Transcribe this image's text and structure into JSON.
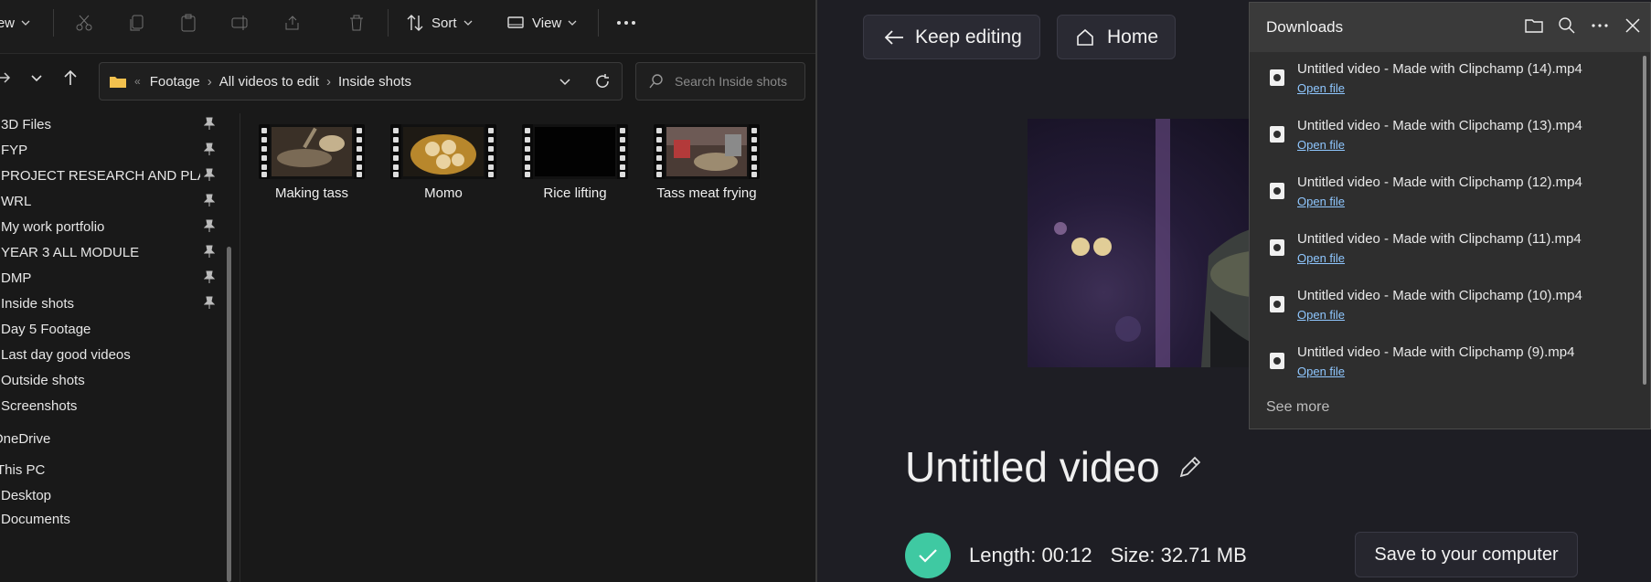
{
  "explorer": {
    "toolbar": {
      "new_label": "New",
      "sort_label": "Sort",
      "view_label": "View"
    },
    "address": {
      "path": [
        "Footage",
        "All videos to edit",
        "Inside shots"
      ]
    },
    "search": {
      "placeholder": "Search Inside shots"
    },
    "nav": {
      "items": [
        {
          "label": "3D Files",
          "pinned": true
        },
        {
          "label": "FYP",
          "pinned": true
        },
        {
          "label": "PROJECT RESEARCH AND PLANN",
          "pinned": true
        },
        {
          "label": "WRL",
          "pinned": true
        },
        {
          "label": "My work portfolio",
          "pinned": true
        },
        {
          "label": "YEAR 3 ALL MODULE",
          "pinned": true
        },
        {
          "label": "DMP",
          "pinned": true
        },
        {
          "label": "Inside shots",
          "pinned": true
        },
        {
          "label": "Day 5 Footage",
          "pinned": false
        },
        {
          "label": "Last day good videos",
          "pinned": false
        },
        {
          "label": "Outside shots",
          "pinned": false
        },
        {
          "label": "Screenshots",
          "pinned": false
        },
        {
          "label": "OneDrive",
          "pinned": false
        },
        {
          "label": "This PC",
          "pinned": false
        },
        {
          "label": "Desktop",
          "pinned": false
        },
        {
          "label": "Documents",
          "pinned": false
        }
      ]
    },
    "files": [
      {
        "name": "Making tass"
      },
      {
        "name": "Momo"
      },
      {
        "name": "Rice lifting"
      },
      {
        "name": "Tass meat frying"
      }
    ]
  },
  "clipchamp": {
    "keep_editing_label": "Keep editing",
    "home_label": "Home",
    "video_title": "Untitled video",
    "length_text": "Length: 00:12",
    "size_text": "Size: 32.71 MB",
    "save_label": "Save to your computer"
  },
  "downloads": {
    "title": "Downloads",
    "items": [
      {
        "name": "Untitled video - Made with Clipchamp (14).mp4",
        "link": "Open file"
      },
      {
        "name": "Untitled video - Made with Clipchamp (13).mp4",
        "link": "Open file"
      },
      {
        "name": "Untitled video - Made with Clipchamp (12).mp4",
        "link": "Open file"
      },
      {
        "name": "Untitled video - Made with Clipchamp (11).mp4",
        "link": "Open file"
      },
      {
        "name": "Untitled video - Made with Clipchamp (10).mp4",
        "link": "Open file"
      },
      {
        "name": "Untitled video - Made with Clipchamp (9).mp4",
        "link": "Open file"
      }
    ],
    "see_more_label": "See more"
  },
  "colors": {
    "explorer_bg": "#191919",
    "clipchamp_bg": "#1e1e24",
    "accent_check": "#3fc9a2",
    "link": "#8fc7ff"
  }
}
